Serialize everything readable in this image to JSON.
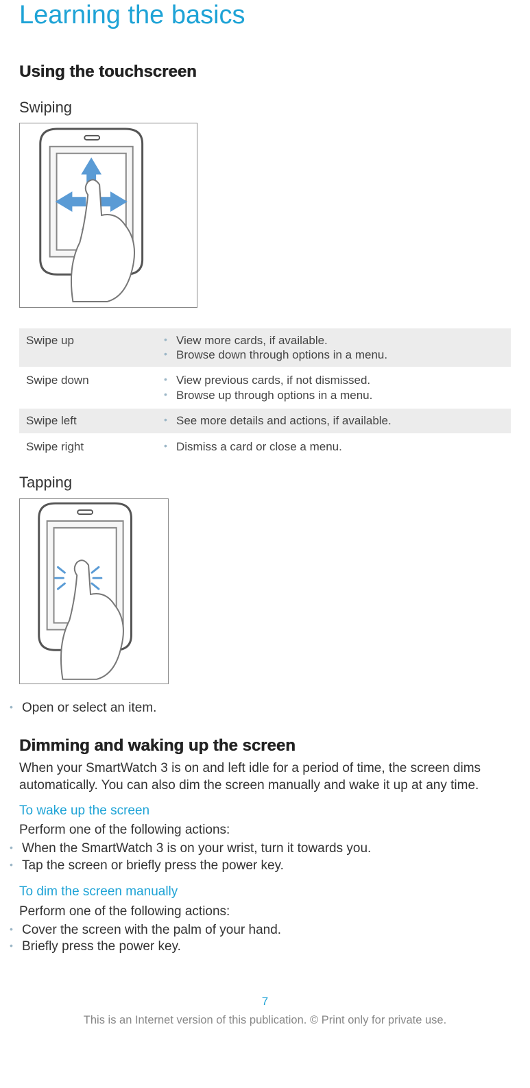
{
  "chapter_title": "Learning the basics",
  "section1": {
    "title": "Using the touchscreen",
    "swiping": {
      "heading": "Swiping",
      "rows": [
        {
          "label": "Swipe up",
          "items": [
            "View more cards, if available.",
            "Browse down through options in a menu."
          ]
        },
        {
          "label": "Swipe down",
          "items": [
            "View previous cards, if not dismissed.",
            "Browse up through options in a menu."
          ]
        },
        {
          "label": "Swipe left",
          "items": [
            "See more details and actions, if available."
          ]
        },
        {
          "label": "Swipe right",
          "items": [
            "Dismiss a card or close a menu."
          ]
        }
      ]
    },
    "tapping": {
      "heading": "Tapping",
      "items": [
        "Open or select an item."
      ]
    }
  },
  "section2": {
    "title": "Dimming and waking up the screen",
    "intro": "When your SmartWatch 3 is on and left idle for a period of time, the screen dims automatically. You can also dim the screen manually and wake it up at any time.",
    "wake": {
      "heading": "To wake up the screen",
      "lead": "Perform one of the following actions:",
      "items": [
        "When the SmartWatch 3 is on your wrist, turn it towards you.",
        "Tap the screen or briefly press the power key."
      ]
    },
    "dim": {
      "heading": "To dim the screen manually",
      "lead": "Perform one of the following actions:",
      "items": [
        "Cover the screen with the palm of your hand.",
        "Briefly press the power key."
      ]
    }
  },
  "page_number": "7",
  "footer": "This is an Internet version of this publication. © Print only for private use."
}
